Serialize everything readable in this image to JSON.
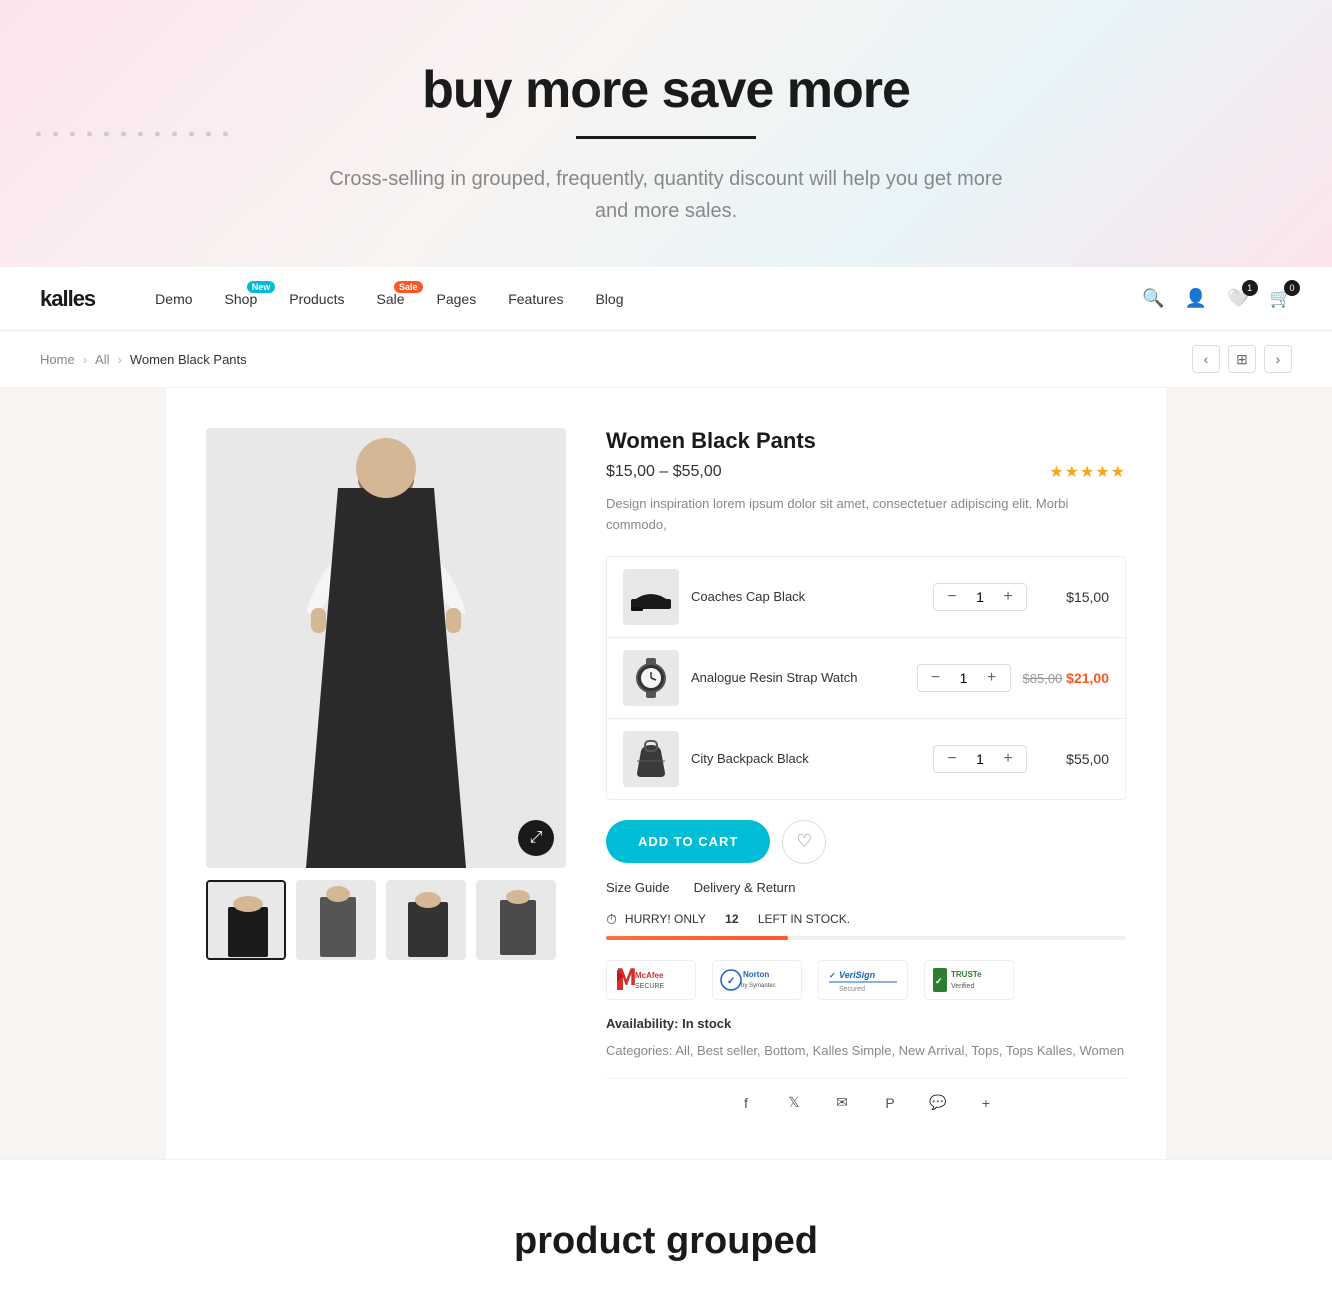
{
  "hero": {
    "title": "buy more save more",
    "subtitle": "Cross-selling in grouped, frequently,  quantity discount will help you get more and more sales."
  },
  "navbar": {
    "logo": "kalles",
    "links": [
      {
        "label": "Demo",
        "badge": null
      },
      {
        "label": "Shop",
        "badge": "New"
      },
      {
        "label": "Products",
        "badge": null
      },
      {
        "label": "Sale",
        "badge": "Sale"
      },
      {
        "label": "Pages",
        "badge": null
      },
      {
        "label": "Features",
        "badge": null
      },
      {
        "label": "Blog",
        "badge": null
      }
    ],
    "wishlist_count": "1",
    "cart_count": "0"
  },
  "breadcrumb": {
    "home": "Home",
    "all": "All",
    "current": "Women Black Pants"
  },
  "product": {
    "name": "Women Black Pants",
    "price": "$15,00 – $55,00",
    "stars": "★★★★★",
    "description": "Design inspiration lorem ipsum dolor sit amet, consectetuer adipiscing elit. Morbi commodo,",
    "items": [
      {
        "name": "Coaches Cap Black",
        "price": "$15,00",
        "price_old": null,
        "price_new": null,
        "qty": "1",
        "icon": "🧢"
      },
      {
        "name": "Analogue Resin Strap Watch",
        "price": "$85,00",
        "price_old": "$85,00",
        "price_new": "$21,00",
        "qty": "1",
        "icon": "⌚"
      },
      {
        "name": "City Backpack Black",
        "price": "$55,00",
        "price_old": null,
        "price_new": null,
        "qty": "1",
        "icon": "👜"
      }
    ],
    "add_to_cart": "ADD TO CART",
    "size_guide": "Size Guide",
    "delivery_return": "Delivery & Return",
    "stock_text": "HURRY! ONLY",
    "stock_count": "12",
    "stock_suffix": "LEFT IN STOCK.",
    "availability_label": "Availability:",
    "availability_value": "In stock",
    "categories_label": "Categories:",
    "categories": "All, Best seller, Bottom, Kalles Simple, New Arrival, Tops, Tops Kalles, Women",
    "trust_badges": [
      {
        "name": "McAfee SECURE",
        "color": "#d32f2f",
        "icon": "🛡"
      },
      {
        "name": "Norton by Symantec",
        "color": "#1565c0",
        "icon": "✓"
      },
      {
        "name": "VeriSign",
        "color": "#1565c0",
        "icon": "✓"
      },
      {
        "name": "TRUSTe Verified",
        "color": "#2e7d32",
        "icon": "✓"
      }
    ]
  },
  "bottom": {
    "title": "product grouped"
  },
  "social": {
    "icons": [
      "f",
      "t",
      "✉",
      "P",
      "m",
      "+"
    ]
  }
}
